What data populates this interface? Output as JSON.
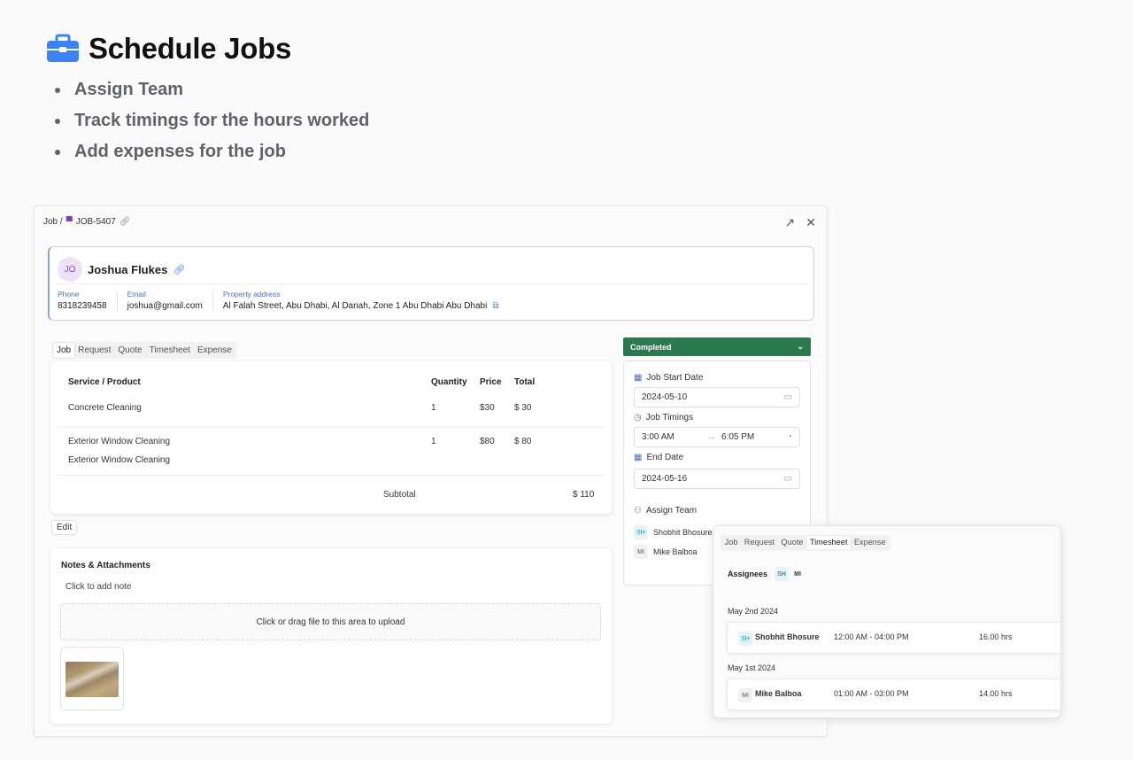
{
  "hero": {
    "title": "Schedule Jobs",
    "bullets": [
      "Assign Team",
      "Track timings for the hours worked",
      "Add expenses for the job"
    ]
  },
  "panel": {
    "breadcrumb": {
      "root": "Job /",
      "job_id": "JOB-5407"
    },
    "customer": {
      "initials": "JO",
      "name": "Joshua Flukes",
      "phone_label": "Phone",
      "phone": "8318239458",
      "email_label": "Email",
      "email": "joshua@gmail.com",
      "address_label": "Property address",
      "address": "Al Falah Street, Abu Dhabi, Al Danah, Zone 1 Abu Dhabi Abu Dhabi"
    },
    "tabs": [
      "Job",
      "Request",
      "Quote",
      "Timesheet",
      "Expense"
    ],
    "active_tab": "Job",
    "services": {
      "headers": {
        "service": "Service / Product",
        "quantity": "Quantity",
        "price": "Price",
        "total": "Total"
      },
      "rows": [
        {
          "name": "Concrete Cleaning",
          "desc": "",
          "qty": "1",
          "price": "$30",
          "total": "$ 30"
        },
        {
          "name": "Exterior Window Cleaning",
          "desc": "Exterior Window Cleaning",
          "qty": "1",
          "price": "$80",
          "total": "$ 80"
        }
      ],
      "subtotal_label": "Subtotal",
      "subtotal": "$ 110"
    },
    "edit_label": "Edit",
    "notes": {
      "title": "Notes & Attachments",
      "add_note": "Click to add note",
      "upload": "Click or drag file to this area to upload"
    },
    "status": "Completed",
    "schedule": {
      "start_label": "Job Start Date",
      "start_date": "2024-05-10",
      "timings_label": "Job Timings",
      "time_from": "3:00 AM",
      "time_to": "6:05 PM",
      "end_label": "End Date",
      "end_date": "2024-05-16",
      "team_label": "Assign Team",
      "team": [
        {
          "initials": "SH",
          "name": "Shobhit Bhosure"
        },
        {
          "initials": "MI",
          "name": "Mike Balboa"
        }
      ]
    }
  },
  "timesheet": {
    "tabs": [
      "Job",
      "Request",
      "Quote",
      "Timesheet",
      "Expense"
    ],
    "active_tab": "Timesheet",
    "assignees_label": "Assignees",
    "assignee_chips": [
      "SH",
      "MI"
    ],
    "entries": [
      {
        "date": "May 2nd 2024",
        "initials": "SH",
        "name": "Shobhit Bhosure",
        "range": "12:00 AM - 04:00 PM",
        "hours": "16.00 hrs"
      },
      {
        "date": "May 1st 2024",
        "initials": "MI",
        "name": "Mike Balboa",
        "range": "01:00 AM - 03:00 PM",
        "hours": "14.00 hrs"
      }
    ]
  },
  "colors": {
    "accent": "#3b82f6",
    "status_green": "#2b7a4f",
    "brand_purple": "#7b3fb8"
  },
  "icons": [
    "briefcase-icon",
    "link-icon",
    "expand-icon",
    "close-icon",
    "external-link-icon",
    "chevron-down-icon",
    "calendar-icon",
    "clock-icon",
    "users-icon",
    "arrow-right-icon"
  ]
}
